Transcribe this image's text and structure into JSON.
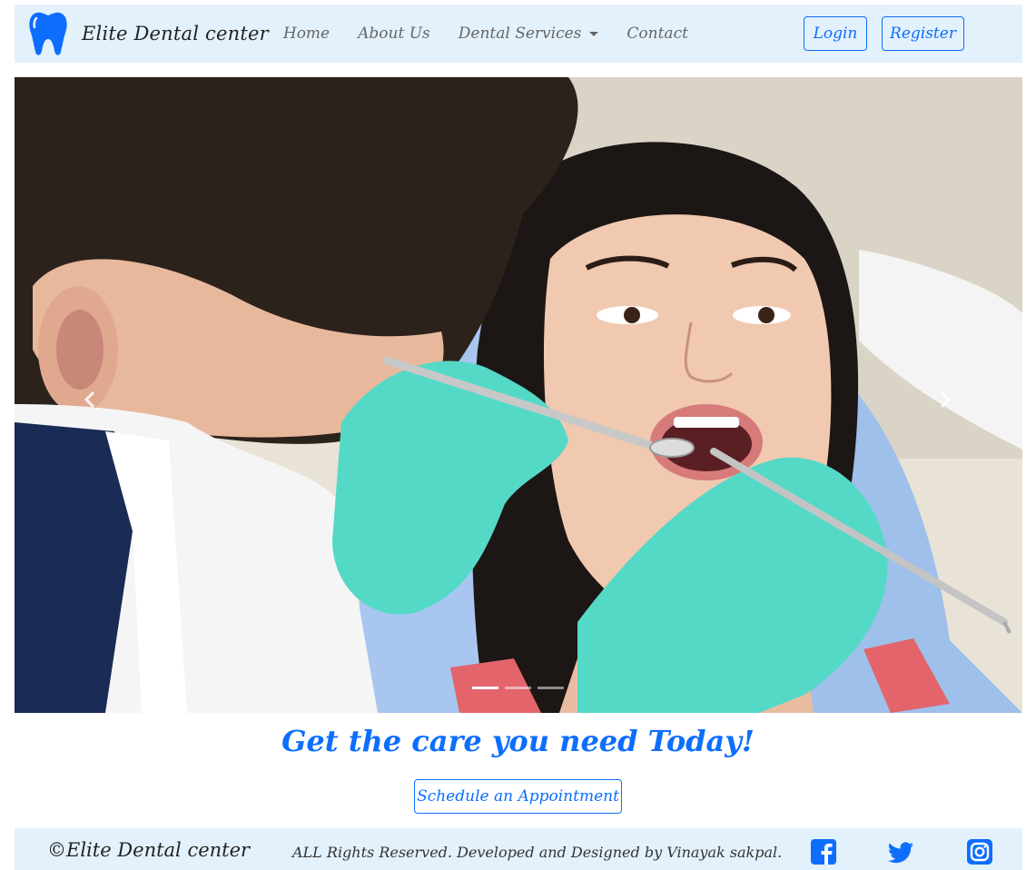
{
  "navbar": {
    "brand_name": "Elite Dental center",
    "links": [
      "Home",
      "About Us",
      "Dental Services",
      "Contact"
    ],
    "login_label": "Login",
    "register_label": "Register"
  },
  "carousel": {
    "slide_count": 3,
    "active_slide": 1,
    "prev_icon": "chevron-left-icon",
    "next_icon": "chevron-right-icon"
  },
  "hero": {
    "tagline": "Get the care you need Today!",
    "cta_label": "Schedule an Appointment"
  },
  "footer": {
    "copyright": "©Elite Dental center",
    "rights": "ALL Rights Reserved. Developed and Designed by Vinayak sakpal.",
    "social_icons": [
      "facebook-icon",
      "twitter-icon",
      "instagram-icon"
    ]
  },
  "colors": {
    "primary": "#0d6efd",
    "nav_bg": "#e3f1fc",
    "glove": "#55d9c7"
  }
}
